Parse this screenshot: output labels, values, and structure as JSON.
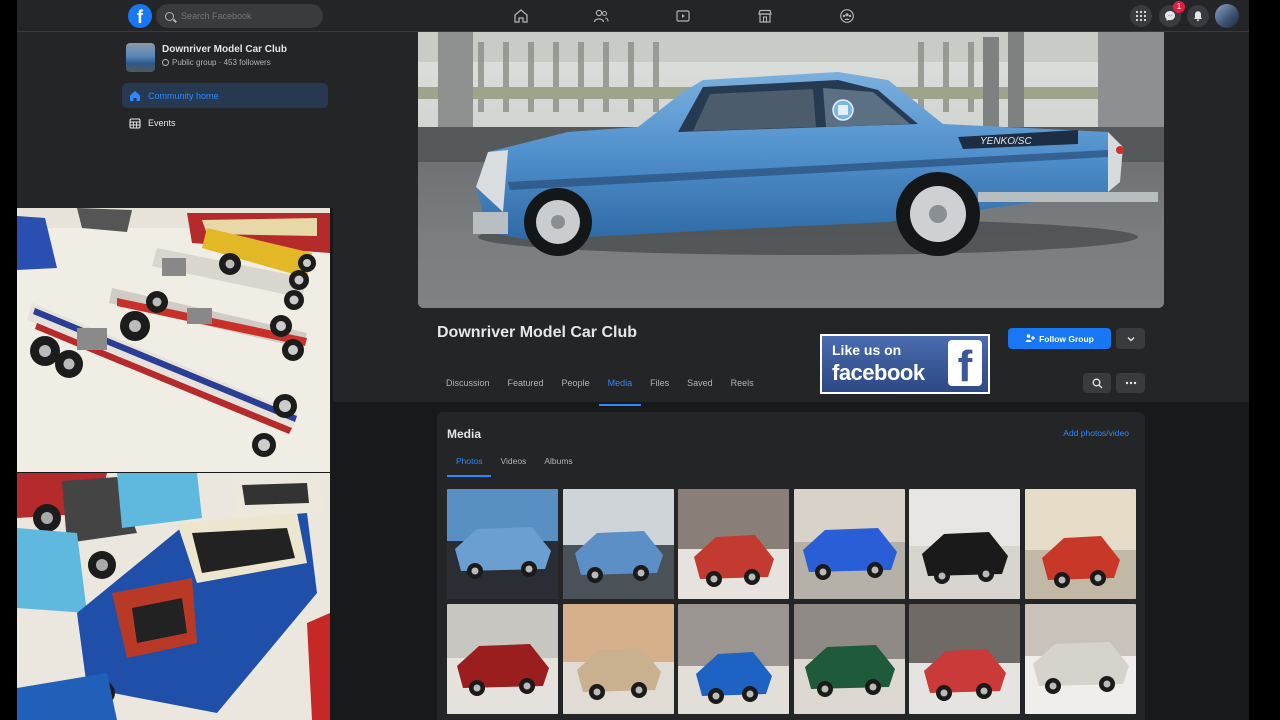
{
  "topbar": {
    "search_placeholder": "Search Facebook",
    "nav_icons": [
      "home-icon",
      "friends-icon",
      "watch-icon",
      "marketplace-icon",
      "groups-icon"
    ],
    "messenger_badge": "1"
  },
  "sidebar": {
    "group_name": "Downriver Model Car Club",
    "group_meta": "Public group · 453 followers",
    "items": [
      {
        "label": "Community home",
        "icon": "home-icon",
        "active": true
      },
      {
        "label": "Events",
        "icon": "calendar-icon",
        "active": false
      }
    ]
  },
  "header": {
    "title": "Downriver Model Car Club",
    "follow_label": "Follow Group",
    "tabs": [
      "Discussion",
      "Featured",
      "People",
      "Media",
      "Files",
      "Saved",
      "Reels"
    ],
    "active_tab": "Media"
  },
  "like_badge": {
    "line1": "Like us on",
    "line2": "facebook",
    "f": "f"
  },
  "media": {
    "title": "Media",
    "add_label": "Add photos/video",
    "tabs": [
      "Photos",
      "Videos",
      "Albums"
    ],
    "active_tab": "Photos",
    "thumbs": [
      {
        "top": "#5a8fc4",
        "bot": "#2a2d33",
        "accent": "#6b9fd1"
      },
      {
        "top": "#cfd4d8",
        "bot": "#4a5258",
        "accent": "#5b8fc6"
      },
      {
        "top": "#8a7f78",
        "bot": "#e6e3de",
        "accent": "#c23a30"
      },
      {
        "top": "#d8d2c8",
        "bot": "#b5b0a8",
        "accent": "#2a5ed6"
      },
      {
        "top": "#e8e6e2",
        "bot": "#d8d5d0",
        "accent": "#1a1a1a"
      },
      {
        "top": "#e6dcc8",
        "bot": "#c2b8a6",
        "accent": "#c73828"
      },
      {
        "top": "#c8c6c0",
        "bot": "#e5e2dd",
        "accent": "#9a1e1e"
      },
      {
        "top": "#d5b08a",
        "bot": "#e0dbd3",
        "accent": "#c9b190"
      },
      {
        "top": "#9a9590",
        "bot": "#e2ded8",
        "accent": "#1e62c4"
      },
      {
        "top": "#8f8a85",
        "bot": "#ddd9d2",
        "accent": "#1f5a3a"
      },
      {
        "top": "#6f6a66",
        "bot": "#e6e4e0",
        "accent": "#c93a38"
      },
      {
        "top": "#c8c2ba",
        "bot": "#f0eeea",
        "accent": "#d6d2cc"
      }
    ]
  },
  "colors": {
    "accent": "#2d88ff",
    "brand": "#1877f2",
    "surface": "#242526",
    "background": "#18191a"
  }
}
